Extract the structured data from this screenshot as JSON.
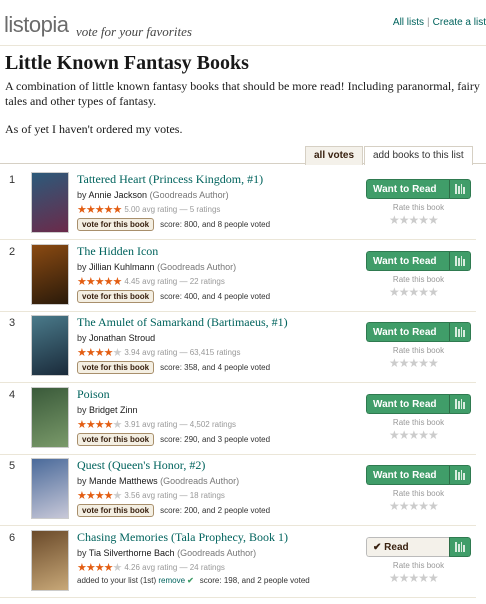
{
  "header": {
    "logo": "listopia",
    "tagline": "vote for your favorites",
    "links": [
      "All lists",
      "Create a list"
    ]
  },
  "list": {
    "title": "Little Known Fantasy Books",
    "description": "A combination of little known fantasy books that should be more read! Including paranormal, fairy tales and other types of fantasy.",
    "note": "As of yet I haven't ordered my votes."
  },
  "tabs": {
    "active": "all votes",
    "other": "add books to this list"
  },
  "common": {
    "by": "by",
    "vote_button": "vote for this book",
    "rate_label": "Rate this book",
    "avg_suffix": "avg rating —",
    "ratings_suffix": "ratings",
    "score_prefix": "score:",
    "people_voted": "people voted",
    "and": "and"
  },
  "books": [
    {
      "rank": "1",
      "title": "Tattered Heart (Princess Kingdom, #1)",
      "author": "Annie Jackson",
      "goodreads_author": "(Goodreads Author)",
      "avg": "5.00",
      "ratings": "5",
      "score": "800",
      "votes": "8",
      "stars": 5,
      "shelf": "Want to Read",
      "cover_colors": [
        "#2c5a7a",
        "#6b2a4a"
      ]
    },
    {
      "rank": "2",
      "title": "The Hidden Icon",
      "author": "Jillian Kuhlmann",
      "goodreads_author": "(Goodreads Author)",
      "avg": "4.45",
      "ratings": "22",
      "score": "400",
      "votes": "4",
      "stars": 4.5,
      "shelf": "Want to Read",
      "cover_colors": [
        "#8a4a12",
        "#2a1a0a"
      ]
    },
    {
      "rank": "3",
      "title": "The Amulet of Samarkand (Bartimaeus, #1)",
      "author": "Jonathan Stroud",
      "goodreads_author": "",
      "avg": "3.94",
      "ratings": "63,415",
      "score": "358",
      "votes": "4",
      "stars": 4,
      "shelf": "Want to Read",
      "cover_colors": [
        "#4a7a8a",
        "#1a2a3a"
      ]
    },
    {
      "rank": "4",
      "title": "Poison",
      "author": "Bridget Zinn",
      "goodreads_author": "",
      "avg": "3.91",
      "ratings": "4,502",
      "score": "290",
      "votes": "3",
      "stars": 4,
      "shelf": "Want to Read",
      "cover_colors": [
        "#3a5a3a",
        "#7a9a6a"
      ]
    },
    {
      "rank": "5",
      "title": "Quest (Queen's Honor, #2)",
      "author": "Mande Matthews",
      "goodreads_author": "(Goodreads Author)",
      "avg": "3.56",
      "ratings": "18",
      "score": "200",
      "votes": "2",
      "stars": 3.5,
      "shelf": "Want to Read",
      "cover_colors": [
        "#4a6a9a",
        "#c8c8d8"
      ]
    },
    {
      "rank": "6",
      "title": "Chasing Memories (Tala Prophecy, Book 1)",
      "author": "Tia Silverthorne Bach",
      "goodreads_author": "(Goodreads Author)",
      "avg": "4.26",
      "ratings": "24",
      "score": "198",
      "votes": "2",
      "stars": 4,
      "shelf": "Read",
      "added_text": "added to your list (1st)",
      "remove_text": "remove",
      "cover_colors": [
        "#6a4a2a",
        "#c8a878"
      ]
    }
  ],
  "colors": {
    "green": "#409d69",
    "link": "#00635d",
    "star": "#e35d12"
  }
}
